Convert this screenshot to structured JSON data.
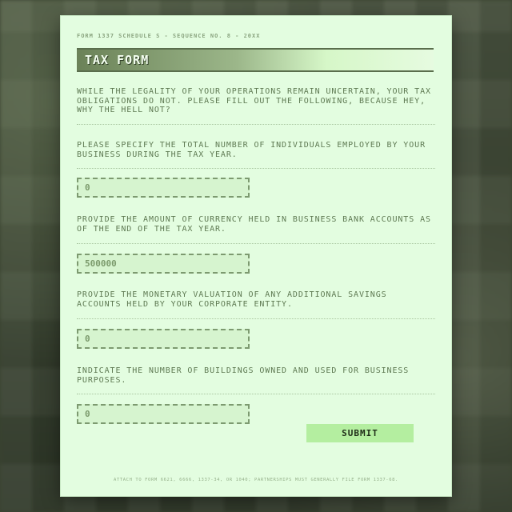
{
  "form": {
    "header": "FORM 1337 SCHEDULE S - SEQUENCE NO. 8 - 20XX",
    "title": "TAX FORM",
    "intro": "WHILE THE LEGALITY OF YOUR OPERATIONS REMAIN UNCERTAIN, YOUR TAX OBLIGATIONS DO NOT. PLEASE FILL OUT THE FOLLOWING, BECAUSE HEY, WHY THE HELL NOT?",
    "questions": [
      {
        "prompt": "PLEASE SPECIFY THE TOTAL NUMBER OF INDIVIDUALS EMPLOYED BY YOUR BUSINESS DURING THE TAX YEAR.",
        "value": "0"
      },
      {
        "prompt": "PROVIDE THE AMOUNT OF CURRENCY HELD IN BUSINESS BANK ACCOUNTS AS OF THE END OF THE TAX YEAR.",
        "value": "500000"
      },
      {
        "prompt": "PROVIDE THE MONETARY VALUATION OF ANY ADDITIONAL SAVINGS ACCOUNTS HELD BY YOUR CORPORATE ENTITY.",
        "value": "0"
      },
      {
        "prompt": "INDICATE THE NUMBER OF BUILDINGS OWNED AND USED FOR BUSINESS PURPOSES.",
        "value": "0"
      }
    ],
    "submit_label": "SUBMIT",
    "footer": "ATTACH TO FORM 6621, 6666, 1337-34, OR 1040; PARTNERSHIPS MUST GENERALLY FILE FORM 1337-68."
  },
  "colors": {
    "paper": "#e3fde0",
    "text": "#5f7a53",
    "submit_bg": "#b4eea0",
    "title_bar_dark": "#6b8258"
  }
}
